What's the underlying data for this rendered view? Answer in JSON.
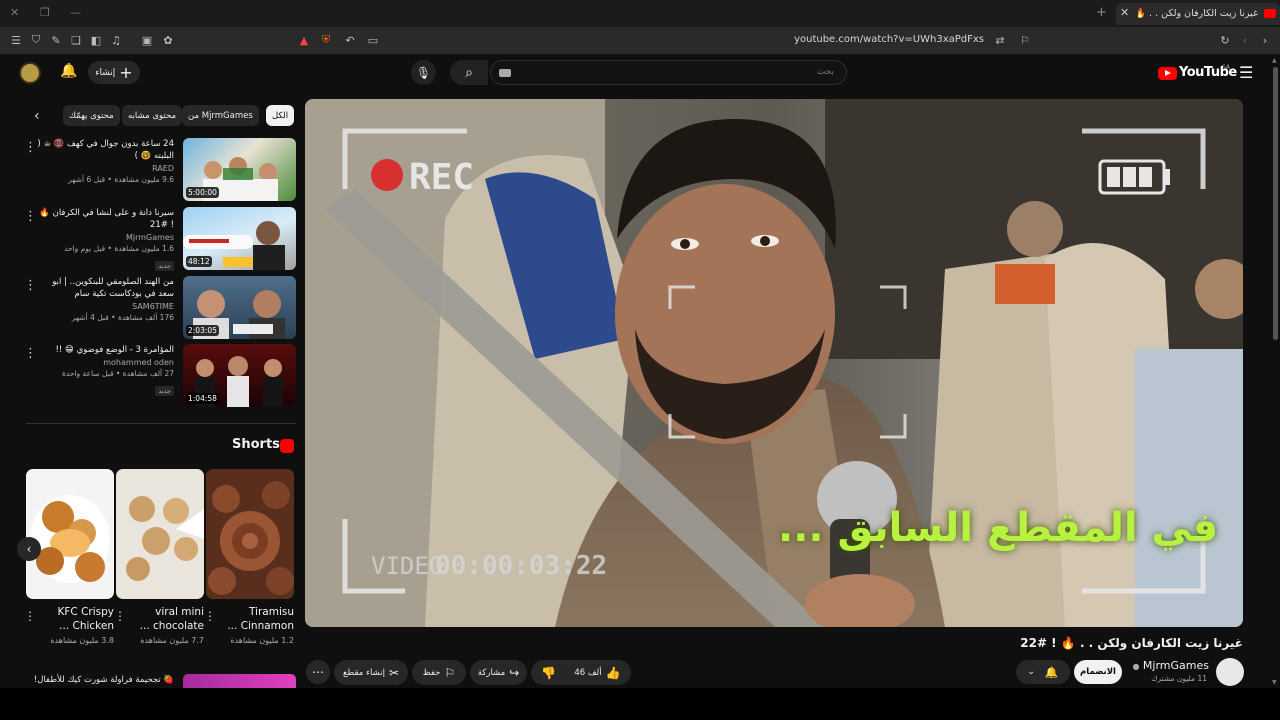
{
  "browser": {
    "tab_title": "غيرنا زيت الكارفان ولكن . . 🔥 ! #22",
    "url": "youtube.com/watch?v=UWh3xaPdFxs"
  },
  "header": {
    "logo_text": "YouTube",
    "region": "SA",
    "search_placeholder": "بحث",
    "create_label": "إنشاء"
  },
  "chips": [
    {
      "label": "الكل",
      "selected": true
    },
    {
      "label": "من MjrmGames",
      "selected": false
    },
    {
      "label": "محتوى مشابه",
      "selected": false
    },
    {
      "label": "محتوى يهمّك",
      "selected": false
    }
  ],
  "related": [
    {
      "title": "24 ساعة بدون جوال في كهف 📵 ☕ ( البلبته 🤓 )",
      "channel": "RAED",
      "meta": "9.6 مليون مشاهدة • قبل 6 أشهر",
      "duration": "5:00:00",
      "new": ""
    },
    {
      "title": "سيرنا دانة و على لنشا في الكرفان 🔥 ! #21",
      "channel": "MjrmGames",
      "meta": "1.6 مليون مشاهدة • قبل يوم واحد",
      "duration": "48:12",
      "new": "جديد"
    },
    {
      "title": "من الهند الصلومفي للبنكوين.. | ابو سعد في بودكاست تكية سام",
      "channel": "SAM6TIME",
      "meta": "176 ألف مشاهدة • قبل 4 أشهر",
      "duration": "2:03:05",
      "new": ""
    },
    {
      "title": "المؤامرة 3 - الوضع فوضوي 😁 !!",
      "channel": "mohammed oden",
      "meta": "27 ألف مشاهدة • قبل ساعة واحدة",
      "duration": "1:04:58",
      "new": "جديد"
    }
  ],
  "shorts": {
    "heading": "Shorts",
    "items": [
      {
        "title": "KFC Crispy Chicken ...",
        "views": "3.8 مليون مشاهدة"
      },
      {
        "title": "viral mini chocolate ...",
        "views": "7.7 مليون مشاهدة"
      },
      {
        "title": "Tiramisu Cinnamon ...",
        "views": "1.2 مليون مشاهدة"
      }
    ]
  },
  "next_item": {
    "title": "🍓 تجحيمة فراولة شورت كيك للأطفال!"
  },
  "player": {
    "rec_text": "REC",
    "video_label": "VIDEO",
    "timecode": "00:00:03:22",
    "caption": "في المقطع السابق ..."
  },
  "video": {
    "title": "غيرنا زيت الكارفان ولكن . . 🔥 ! #22",
    "channel": "MjrmGames",
    "subscribers": "11 مليون مشترك",
    "join_label": "الانضمام",
    "likes": "46 ألف",
    "share_label": "مشاركة",
    "save_label": "حفظ",
    "clip_label": "إنشاء مقطع"
  },
  "colors": {
    "accent": "#ff0000",
    "caption": "#b7f23e",
    "background": "#0f0f0f"
  }
}
